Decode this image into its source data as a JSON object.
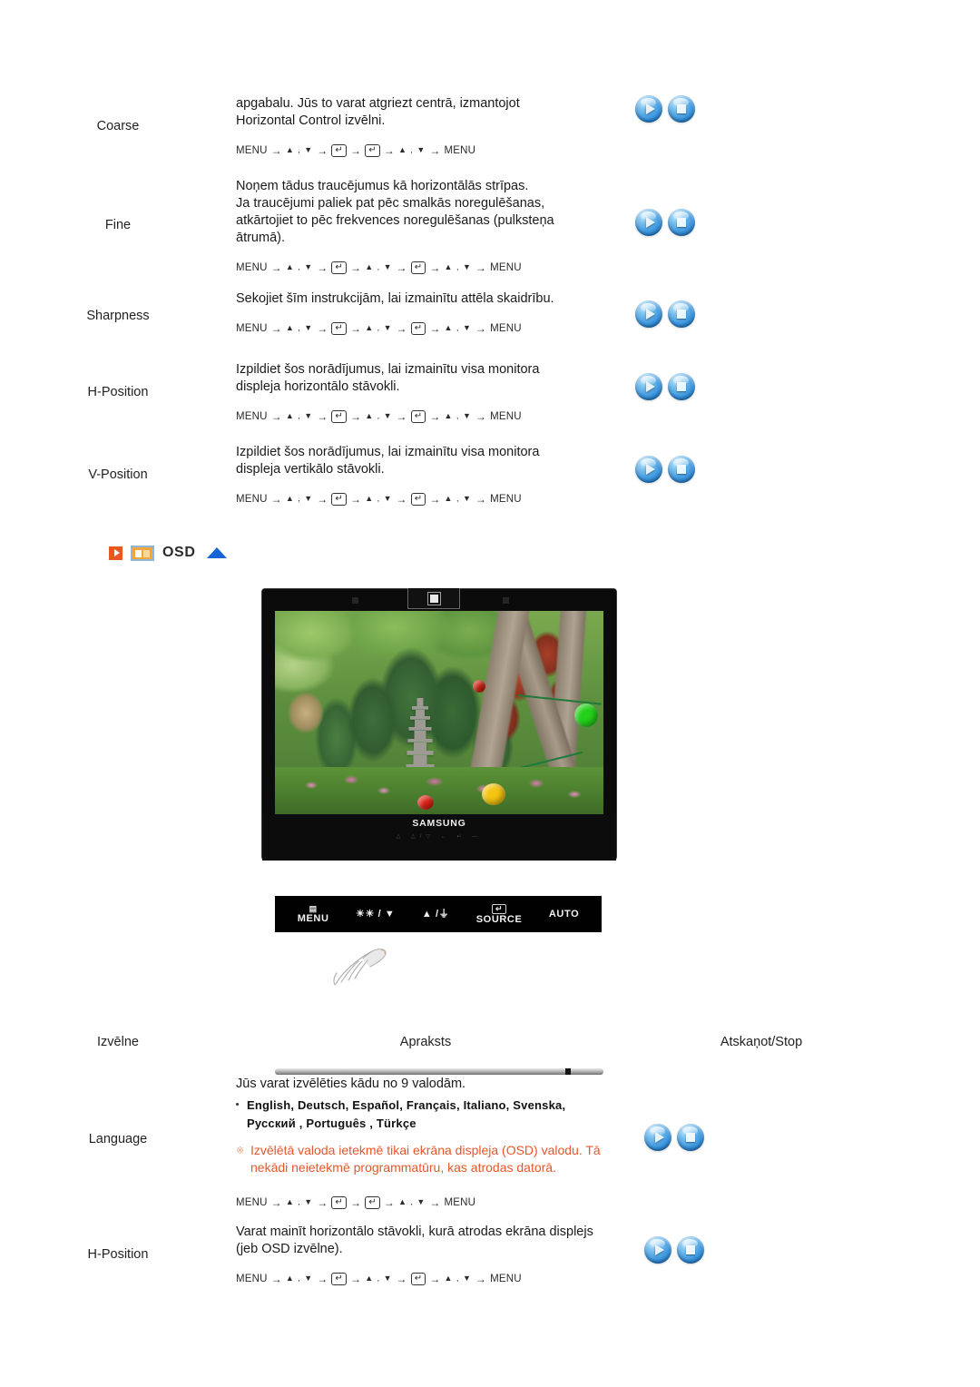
{
  "nav_sequences": {
    "short": [
      "MENU",
      "▲ , ▼",
      "enter",
      "enter",
      "▲ , ▼",
      "MENU"
    ],
    "long": [
      "MENU",
      "▲ , ▼",
      "enter",
      "▲ , ▼",
      "enter",
      "▲ , ▼",
      "MENU"
    ],
    "menu_label": "MENU",
    "updown_label": "▲ , ▼",
    "enter_glyph": "↵",
    "arrow_glyph": "→"
  },
  "top_rows": [
    {
      "menu": "Coarse",
      "lines": [
        "apgabalu. Jūs to varat atgriezt centrā, izmantojot",
        "Horizontal Control izvēlni."
      ],
      "seq": "short"
    },
    {
      "menu": "Fine",
      "lines": [
        "Noņem tādus traucējumus kā horizontālās strīpas.",
        "Ja traucējumi paliek pat pēc smalkās noregulēšanas,",
        "atkārtojiet to pēc frekvences noregulēšanas (pulksteņa",
        "ātrumā)."
      ],
      "seq": "long"
    },
    {
      "menu": "Sharpness",
      "lines": [
        "Sekojiet šīm instrukcijām, lai izmainītu attēla skaidrību."
      ],
      "seq": "long"
    },
    {
      "menu": "H-Position",
      "lines": [
        "Izpildiet šos norādījumus, lai izmainītu visa monitora",
        "displeja horizontālo stāvokli."
      ],
      "seq": "long"
    },
    {
      "menu": "V-Position",
      "lines": [
        "Izpildiet šos norādījumus, lai izmainītu visa monitora",
        "displeja vertikālo stāvokli."
      ],
      "seq": "long"
    }
  ],
  "osd_section": {
    "title": "OSD",
    "arrow_icon": "play-marker-icon",
    "monitor_icon": "osd-monitor-icon",
    "top_icon": "scroll-to-top-triangle-icon",
    "accent_orange": "#e8581f",
    "accent_blue": "#1565d8"
  },
  "monitor": {
    "brand": "SAMSUNG",
    "bezel_mini_labels": "△ △/▽ ← ↵ —"
  },
  "control_bar": {
    "buttons": [
      {
        "name": "menu-button",
        "symbol": "▤",
        "label": "MENU"
      },
      {
        "name": "brightness-down-button",
        "symbol": "",
        "label": "☀☀ / ▼"
      },
      {
        "name": "volume-up-button",
        "symbol": "",
        "label": "▲ /⏚"
      },
      {
        "name": "source-button",
        "symbol": "↵",
        "label": "SOURCE"
      },
      {
        "name": "auto-button",
        "symbol": "",
        "label": "AUTO"
      }
    ]
  },
  "table_header": {
    "col_menu": "Izvēlne",
    "col_description": "Apraksts",
    "col_playstop": "Atskaņot/Stop"
  },
  "bottom_rows": [
    {
      "menu": "Language",
      "intro": "Jūs varat izvēlēties kādu no 9 valodām.",
      "languages_line1": "English, Deutsch, Español, Français,  Italiano, Svenska,",
      "languages_line2": "Русский , Português , Türkçe",
      "warning_line1": "Izvēlētā valoda ietekmē tikai ekrāna displeja (OSD) valodu. Tā",
      "warning_line2": "nekādi neietekmē programmatūru, kas atrodas datorā.",
      "warning_mark": "※",
      "warning_color": "#e8562a",
      "seq": "short"
    },
    {
      "menu": "H-Position",
      "lines": [
        "Varat mainīt horizontālo stāvokli, kurā atrodas ekrāna displejs",
        "(jeb OSD izvēlne)."
      ],
      "seq": "long"
    }
  ],
  "buttons": {
    "play_name": "play-button",
    "stop_name": "stop-button"
  }
}
